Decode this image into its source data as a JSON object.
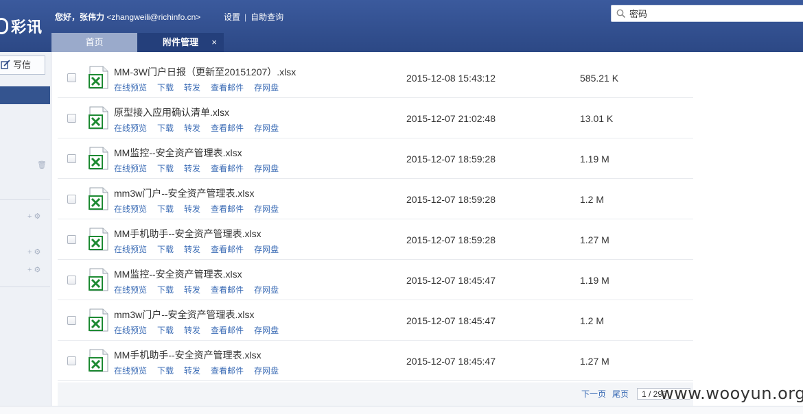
{
  "header": {
    "logo_text": "彩讯",
    "greeting": "您好，张伟力",
    "email": "<zhangweili@richinfo.cn>",
    "links": [
      "设置",
      "自助查询"
    ],
    "search_value": "密码"
  },
  "tabs": [
    {
      "label": "首页"
    },
    {
      "label": "附件管理",
      "close": "×"
    }
  ],
  "sidebar": {
    "write_label": "写信"
  },
  "actions": [
    "在线预览",
    "下载",
    "转发",
    "查看邮件",
    "存网盘"
  ],
  "files": [
    {
      "name": "MM-3W门户日报（更新至20151207）.xlsx",
      "date": "2015-12-08 15:43:12",
      "size": "585.21 K"
    },
    {
      "name": "原型接入应用确认清单.xlsx",
      "date": "2015-12-07 21:02:48",
      "size": "13.01 K"
    },
    {
      "name": "MM监控--安全资产管理表.xlsx",
      "date": "2015-12-07 18:59:28",
      "size": "1.19 M"
    },
    {
      "name": "mm3w门户--安全资产管理表.xlsx",
      "date": "2015-12-07 18:59:28",
      "size": "1.2 M"
    },
    {
      "name": "MM手机助手--安全资产管理表.xlsx",
      "date": "2015-12-07 18:59:28",
      "size": "1.27 M"
    },
    {
      "name": "MM监控--安全资产管理表.xlsx",
      "date": "2015-12-07 18:45:47",
      "size": "1.19 M"
    },
    {
      "name": "mm3w门户--安全资产管理表.xlsx",
      "date": "2015-12-07 18:45:47",
      "size": "1.2 M"
    },
    {
      "name": "MM手机助手--安全资产管理表.xlsx",
      "date": "2015-12-07 18:45:47",
      "size": "1.27 M"
    }
  ],
  "pager": {
    "next": "下一页",
    "last": "尾页",
    "page": "1 / 293"
  },
  "watermark": "www.wooyun.org",
  "colors": {
    "header_bg": "#2f4d8e",
    "active_tab": "#243f7b",
    "link": "#3a6bb5",
    "excel_green": "#1d8a32"
  }
}
